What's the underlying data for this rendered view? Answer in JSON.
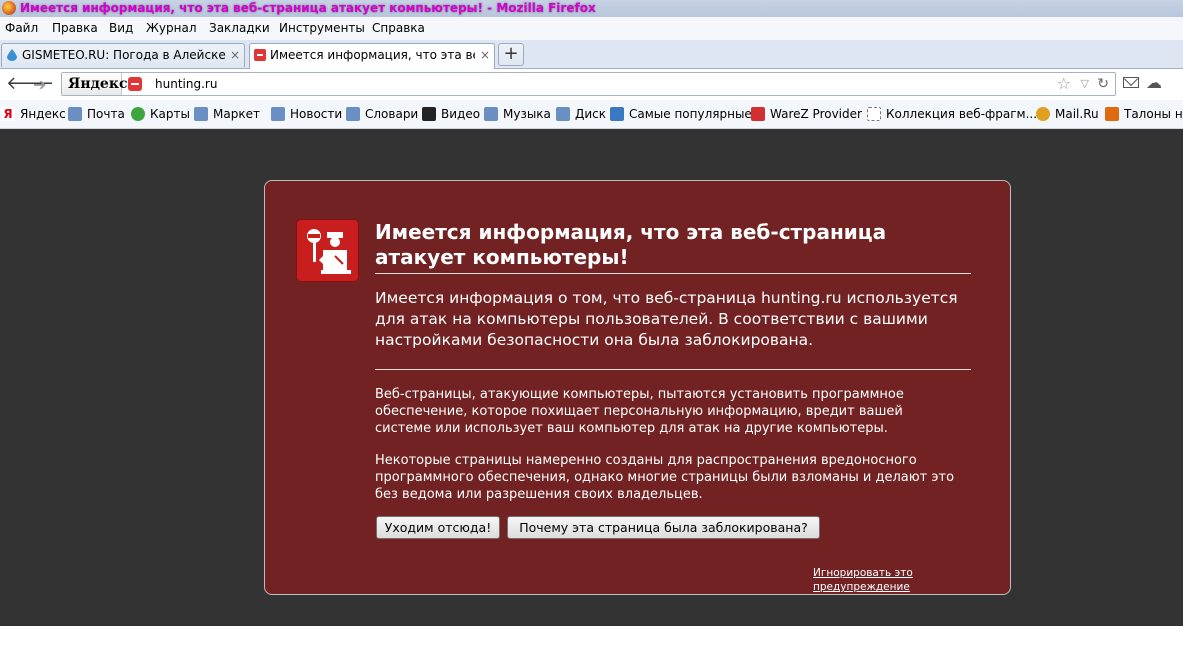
{
  "window": {
    "title": "Имеется информация, что эта веб-страница атакует компьютеры! - Mozilla Firefox",
    "app_icon": "firefox-icon"
  },
  "menu": [
    "Файл",
    "Правка",
    "Вид",
    "Журнал",
    "Закладки",
    "Инструменты",
    "Справка"
  ],
  "tabs": [
    {
      "label": "GISMETEO.RU: Погода в Алейске...",
      "icon": "gismeteo-drop-icon",
      "close": "×",
      "active": false
    },
    {
      "label": "Имеется информация, что эта ве...",
      "icon": "blocked-site-icon",
      "close": "×",
      "active": true
    }
  ],
  "new_tab_label": "+",
  "navbar": {
    "search_engine_label": "Яндекс",
    "url": "hunting.ru"
  },
  "bookmarks": [
    {
      "label": "Яндекс",
      "icon": "yandex-icon",
      "color": "#e1001a"
    },
    {
      "label": "Почта",
      "icon": "mail-icon",
      "color": "#6a8fc2"
    },
    {
      "label": "Карты",
      "icon": "maps-icon",
      "color": "#3da53d"
    },
    {
      "label": "Маркет",
      "icon": "market-icon",
      "color": "#6a8fc2"
    },
    {
      "label": "Новости",
      "icon": "news-icon",
      "color": "#6a8fc2"
    },
    {
      "label": "Словари",
      "icon": "dictionary-icon",
      "color": "#6a8fc2"
    },
    {
      "label": "Видео",
      "icon": "video-icon",
      "color": "#222222"
    },
    {
      "label": "Музыка",
      "icon": "music-icon",
      "color": "#6a8fc2"
    },
    {
      "label": "Диск",
      "icon": "disk-icon",
      "color": "#6a8fc2"
    },
    {
      "label": "Самые популярные",
      "icon": "popular-icon",
      "color": "#3a78c2"
    },
    {
      "label": "WareZ Provider",
      "icon": "warez-icon",
      "color": "#d23030"
    },
    {
      "label": "Коллекция веб-фрагм...",
      "icon": "web-slice-icon",
      "color": "#ffffff"
    },
    {
      "label": "Mail.Ru",
      "icon": "mailru-icon",
      "color": "#e0a020"
    },
    {
      "label": "Талоны на",
      "icon": "coupons-icon",
      "color": "#e06a10"
    }
  ],
  "warning": {
    "title": "Имеется информация, что эта веб-страница атакует компьютеры!",
    "lead": "Имеется информация о том, что веб-страница hunting.ru используется для атак на компьютеры пользователей. В соответствии с вашими настройками безопасности она была заблокирована.",
    "desc1": "Веб-страницы, атакующие компьютеры, пытаются установить программное обеспечение, которое похищает персональную информацию, вредит вашей системе или использует ваш компьютер для атак на другие компьютеры.",
    "desc2": "Некоторые страницы намеренно созданы для распространения вредоносного программного обеспечения, однако многие страницы были взломаны и делают это без ведома или разрешения своих владельцев.",
    "get_out_button": "Уходим отсюда!",
    "why_blocked_button": "Почему эта страница была заблокирована?",
    "ignore_link": "Игнорировать это предупреждение"
  },
  "colors": {
    "panel_background": "#722222",
    "page_background": "#333333",
    "shield_red": "#c81e1e"
  }
}
